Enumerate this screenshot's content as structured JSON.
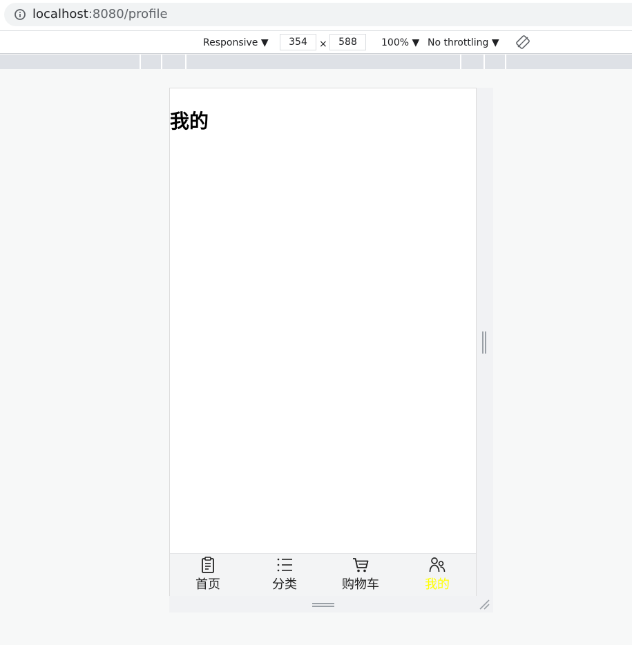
{
  "browser": {
    "url_host": "localhost",
    "url_rest": ":8080/profile"
  },
  "device_toolbar": {
    "device_mode": "Responsive ▼",
    "width": "354",
    "times": "×",
    "height": "588",
    "zoom": "100% ▼",
    "throttling": "No throttling ▼"
  },
  "page": {
    "title": "我的"
  },
  "tabbar": {
    "active_color": "#ffff00",
    "items": [
      {
        "label": "首页",
        "icon": "clipboard-icon"
      },
      {
        "label": "分类",
        "icon": "list-icon"
      },
      {
        "label": "购物车",
        "icon": "cart-icon"
      },
      {
        "label": "我的",
        "icon": "users-icon",
        "active": true
      }
    ]
  }
}
